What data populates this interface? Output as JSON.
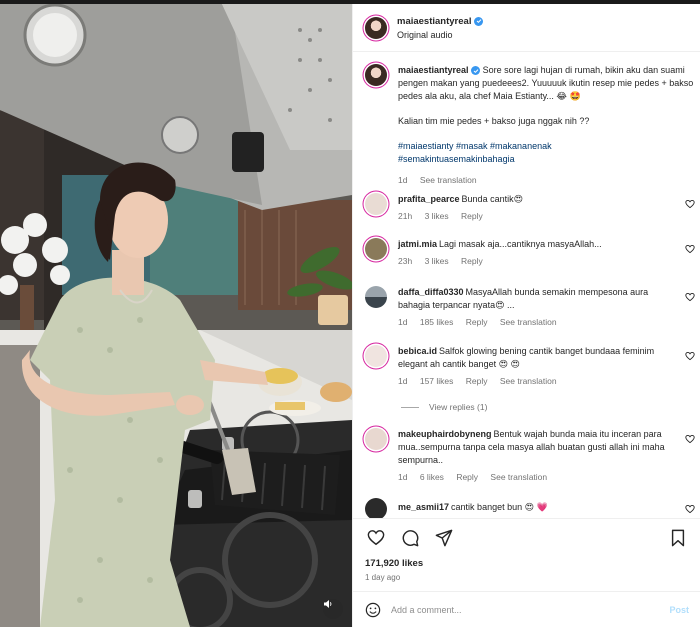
{
  "header": {
    "username": "maiaestiantyreal",
    "subtitle": "Original audio",
    "more_icon": "more-horizontal-icon"
  },
  "caption": {
    "username": "maiaestiantyreal",
    "text": "Sore sore lagi hujan di rumah, bikin aku dan suami pengen makan yang puedeees2. Yuuuuuk ikutin resep mie pedes + bakso pedes ala aku, ala chef Maia Estianty... 😂 🤩",
    "text2": "Kalian tim mie pedes + bakso juga nggak nih ??",
    "hashtags_line1": "#maiaestianty #masak #makananenak",
    "hashtags_line2": "#semakintuasemakinbahagia",
    "time": "1d",
    "see_translation": "See translation"
  },
  "comments": [
    {
      "user": "prafita_pearce",
      "text": "Bunda cantik😍",
      "time": "21h",
      "likes": "3 likes",
      "reply": "Reply",
      "avatar_color": "#e9dcd4"
    },
    {
      "user": "jatmi.mia",
      "text": "Lagi masak aja...cantiknya masyaAllah...",
      "time": "23h",
      "likes": "3 likes",
      "reply": "Reply",
      "avatar_color": "#8a7a5a"
    },
    {
      "user": "daffa_diffa0330",
      "text": "MasyaAllah bunda semakin mempesona aura bahagia terpancar nyata😍 ...",
      "time": "1d",
      "likes": "185 likes",
      "reply": "Reply",
      "see_translation": "See translation",
      "avatar_color": "#4a5560"
    },
    {
      "user": "bebica.id",
      "text": "Salfok glowing bening cantik banget bundaaa feminim elegant ah cantik banget 😍 😍",
      "time": "1d",
      "likes": "157 likes",
      "reply": "Reply",
      "see_translation": "See translation",
      "avatar_color": "#f0e4e0"
    },
    {
      "user": "makeuphairdobyneng",
      "text": "Bentuk wajah bunda maia itu inceran para mua..sempurna tanpa cela masya allah buatan gusti allah ini maha sempurna..",
      "time": "1d",
      "likes": "6 likes",
      "reply": "Reply",
      "see_translation": "See translation",
      "avatar_color": "#e8d8d0"
    },
    {
      "user": "me_asmii17",
      "text": "cantik banget bun 😍 💗",
      "avatar_color": "#2a2a2a"
    }
  ],
  "view_replies": "View replies (1)",
  "actions": {
    "like_icon": "heart-icon",
    "comment_icon": "comment-icon",
    "share_icon": "share-icon",
    "save_icon": "bookmark-icon"
  },
  "likes": "171,920 likes",
  "posted": "1 day ago",
  "composer": {
    "emoji_icon": "emoji-icon",
    "placeholder": "Add a comment...",
    "post_label": "Post"
  },
  "media": {
    "mute_icon": "speaker-icon"
  }
}
